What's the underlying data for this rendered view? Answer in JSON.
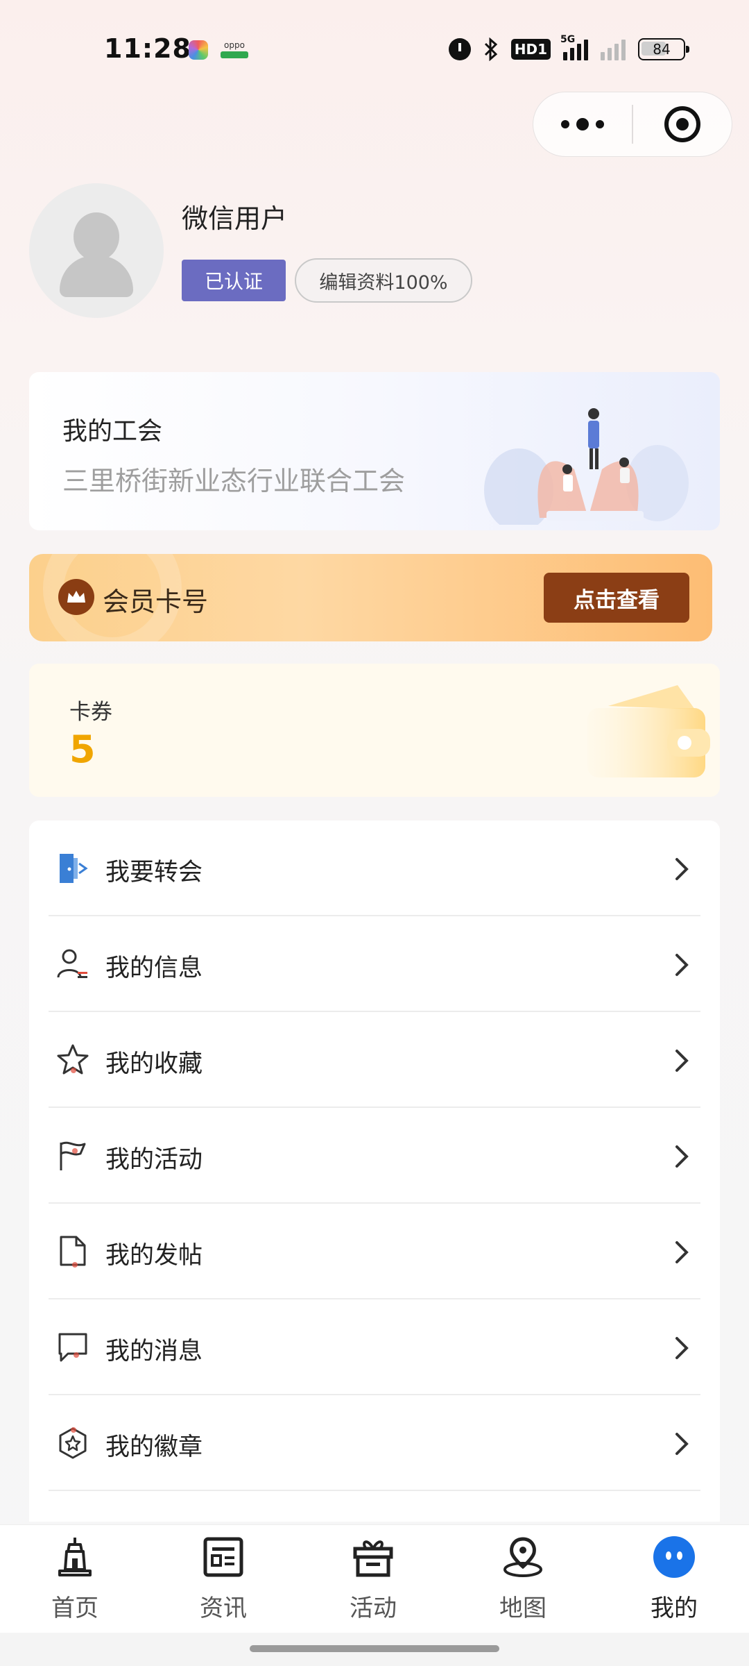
{
  "status_bar": {
    "time": "11:28",
    "battery": "84",
    "hd_label": "HD1",
    "network": "5G",
    "oppo_label": "oppo"
  },
  "profile": {
    "username": "微信用户",
    "verified_label": "已认证",
    "edit_label": "编辑资料100%"
  },
  "union": {
    "title": "我的工会",
    "name": "三里桥街新业态行业联合工会"
  },
  "member": {
    "label": "会员卡号",
    "button": "点击查看"
  },
  "coupon": {
    "label": "卡券",
    "count": "5"
  },
  "menu": [
    {
      "label": "我要转会",
      "icon": "transfer-door-icon"
    },
    {
      "label": "我的信息",
      "icon": "user-info-icon"
    },
    {
      "label": "我的收藏",
      "icon": "star-icon"
    },
    {
      "label": "我的活动",
      "icon": "flag-icon"
    },
    {
      "label": "我的发帖",
      "icon": "document-icon"
    },
    {
      "label": "我的消息",
      "icon": "message-icon"
    },
    {
      "label": "我的徽章",
      "icon": "badge-icon"
    }
  ],
  "tabs": [
    {
      "label": "首页",
      "icon": "home-tower-icon"
    },
    {
      "label": "资讯",
      "icon": "news-icon"
    },
    {
      "label": "活动",
      "icon": "gift-icon"
    },
    {
      "label": "地图",
      "icon": "map-pin-icon"
    },
    {
      "label": "我的",
      "icon": "me-face-icon"
    }
  ],
  "colors": {
    "verified_bg": "#6b6cc1",
    "member_button": "#8b3e15",
    "coupon_count": "#f0a500",
    "tab_active": "#1a73e8"
  }
}
